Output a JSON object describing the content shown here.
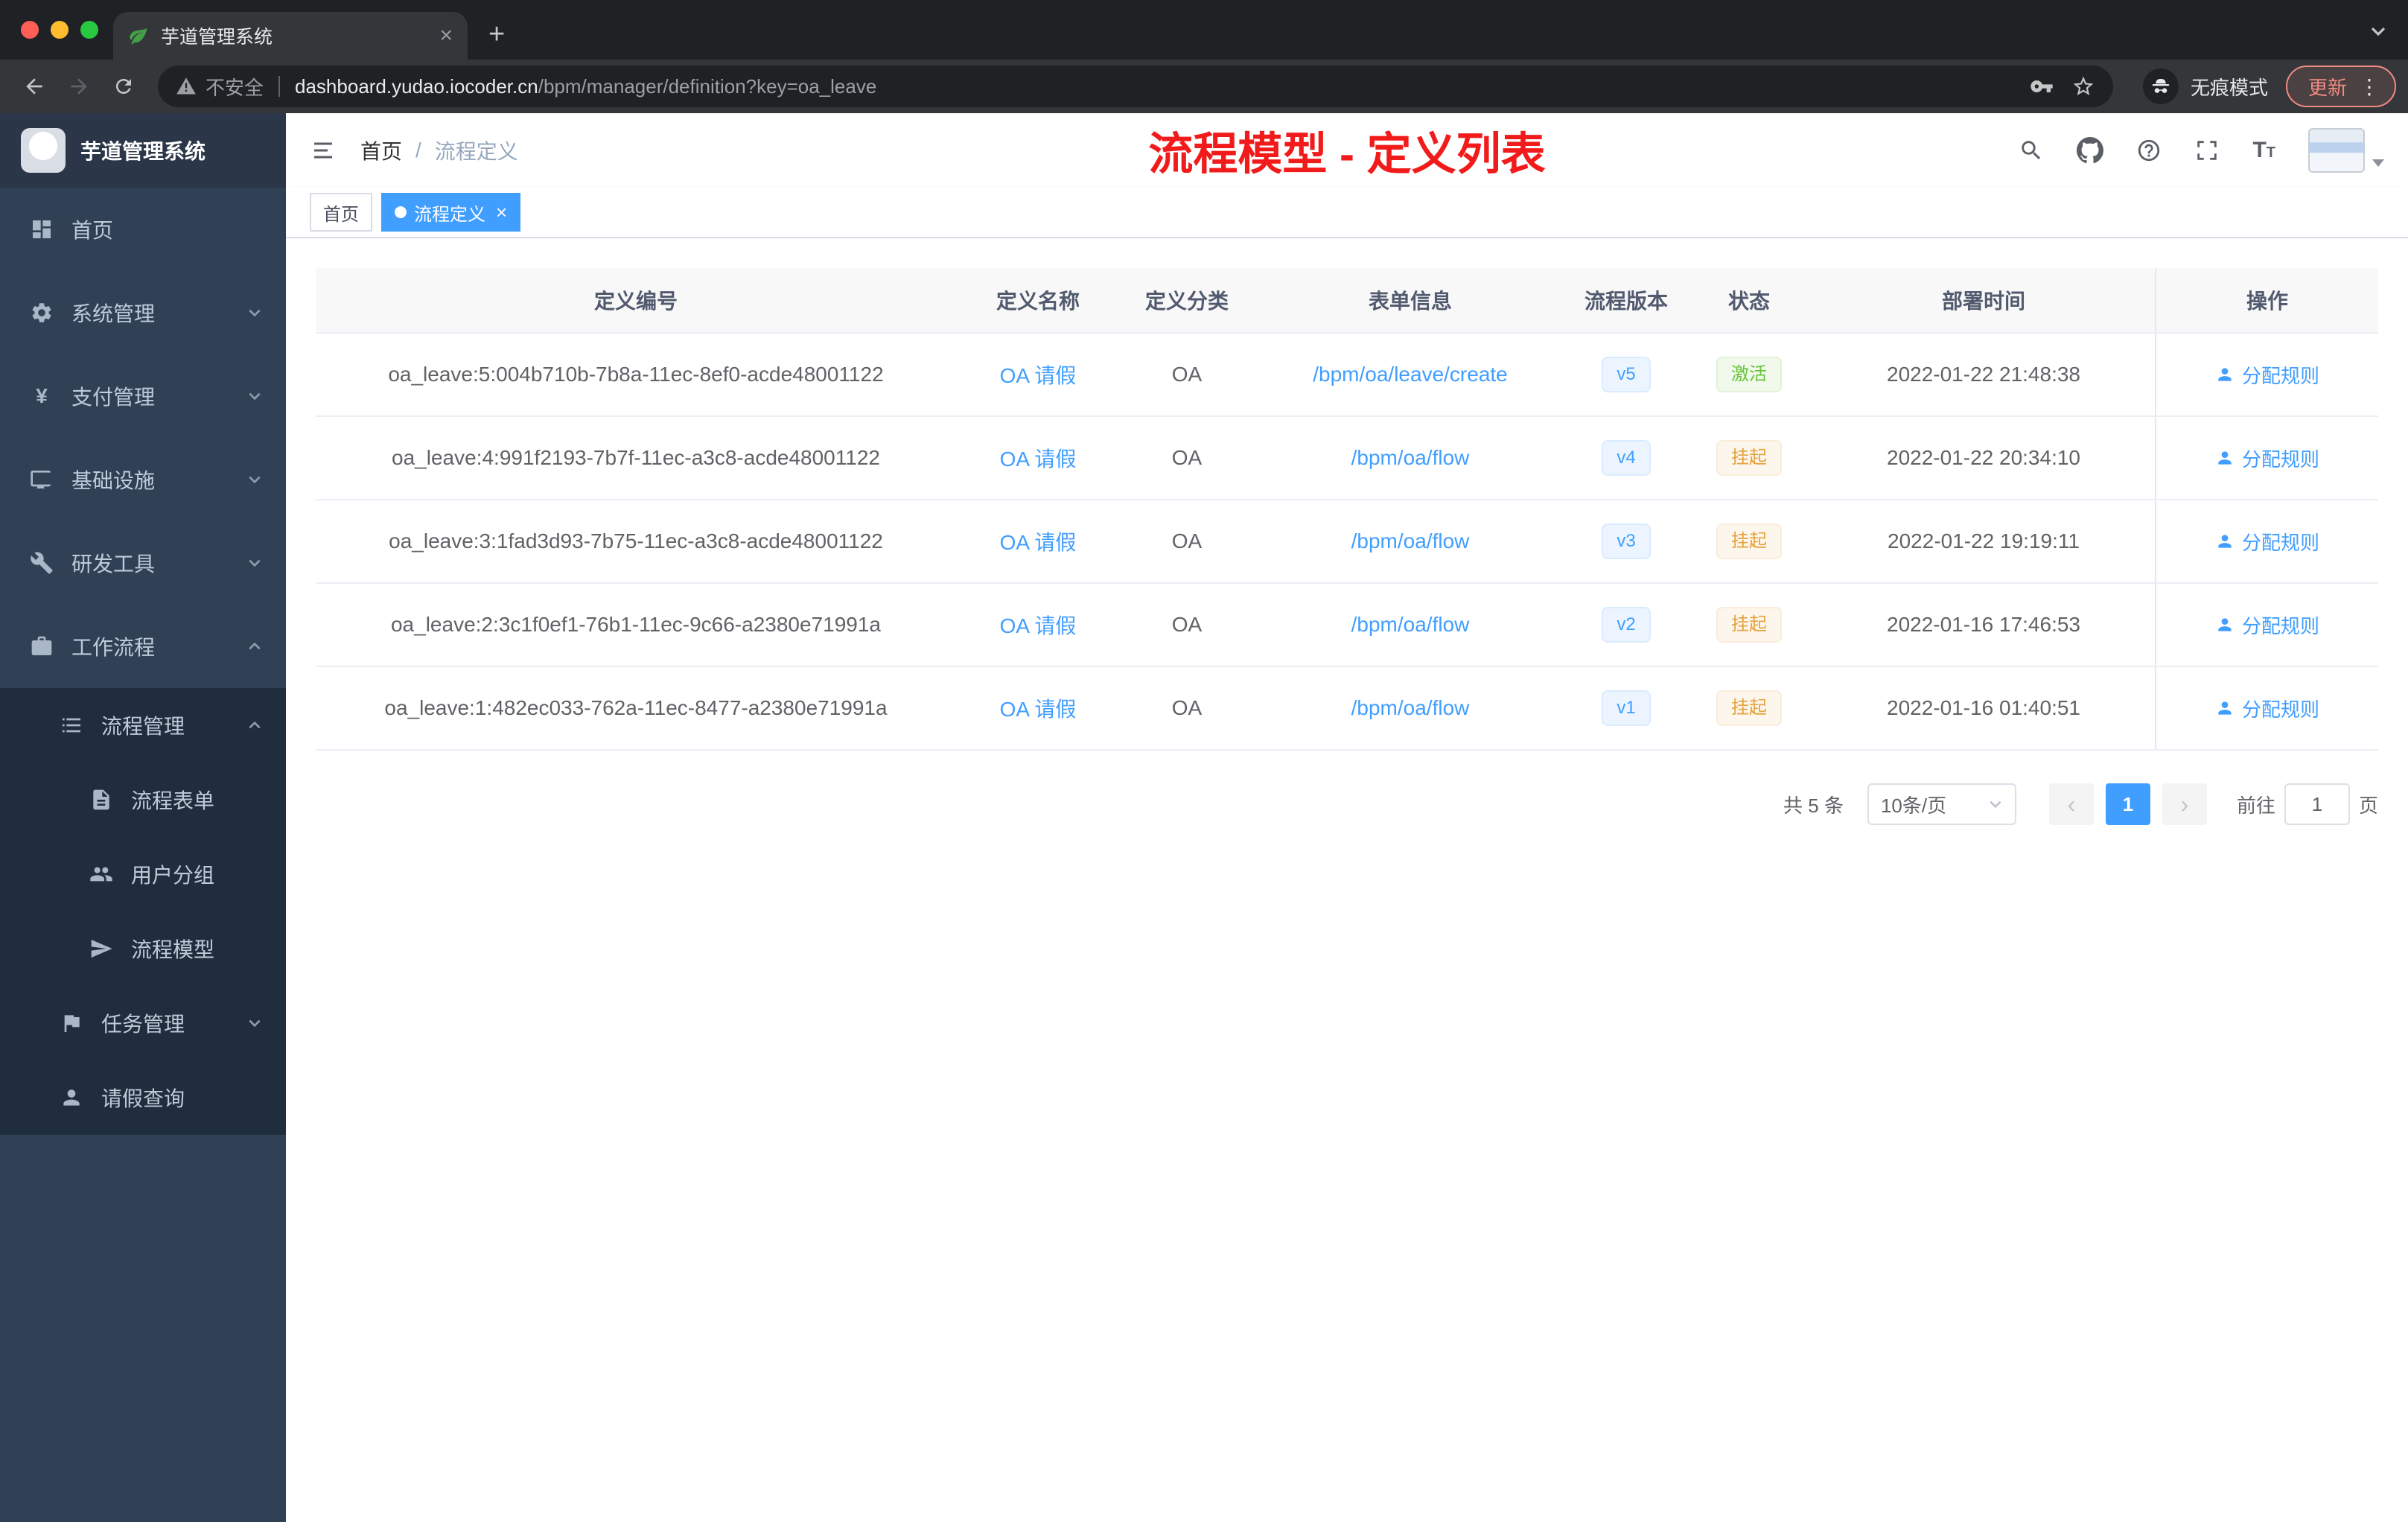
{
  "browser": {
    "tab": {
      "title": "芋道管理系统"
    },
    "address": {
      "security_label": "不安全",
      "domain": "dashboard.yudao.iocoder.cn",
      "path": "/bpm/manager/definition?key=oa_leave"
    },
    "incognito_label": "无痕模式",
    "update_label": "更新"
  },
  "icons": {
    "close": "×",
    "plus": "+",
    "kebab": "⋮",
    "chevron_prev": "‹",
    "chevron_next": "›"
  },
  "sidebar": {
    "logo_title": "芋道管理系统",
    "items": [
      {
        "label": "首页"
      },
      {
        "label": "系统管理"
      },
      {
        "label": "支付管理"
      },
      {
        "label": "基础设施"
      },
      {
        "label": "研发工具"
      },
      {
        "label": "工作流程"
      },
      {
        "label": "流程管理"
      },
      {
        "label": "流程表单"
      },
      {
        "label": "用户分组"
      },
      {
        "label": "流程模型"
      },
      {
        "label": "任务管理"
      },
      {
        "label": "请假查询"
      }
    ]
  },
  "navbar": {
    "breadcrumb": [
      "首页",
      "流程定义"
    ],
    "breadcrumb_separator": "/"
  },
  "annotation": "流程模型 - 定义列表",
  "tags": [
    {
      "label": "首页"
    },
    {
      "label": "流程定义"
    }
  ],
  "table": {
    "columns": [
      "定义编号",
      "定义名称",
      "定义分类",
      "表单信息",
      "流程版本",
      "状态",
      "部署时间",
      "操作"
    ],
    "rows": [
      {
        "id": "oa_leave:5:004b710b-7b8a-11ec-8ef0-acde48001122",
        "name": "OA 请假",
        "category": "OA",
        "form": "/bpm/oa/leave/create",
        "version": "v5",
        "status": "激活",
        "status_type": "success",
        "deploy_time": "2022-01-22 21:48:38",
        "action": "分配规则"
      },
      {
        "id": "oa_leave:4:991f2193-7b7f-11ec-a3c8-acde48001122",
        "name": "OA 请假",
        "category": "OA",
        "form": "/bpm/oa/flow",
        "version": "v4",
        "status": "挂起",
        "status_type": "warning",
        "deploy_time": "2022-01-22 20:34:10",
        "action": "分配规则"
      },
      {
        "id": "oa_leave:3:1fad3d93-7b75-11ec-a3c8-acde48001122",
        "name": "OA 请假",
        "category": "OA",
        "form": "/bpm/oa/flow",
        "version": "v3",
        "status": "挂起",
        "status_type": "warning",
        "deploy_time": "2022-01-22 19:19:11",
        "action": "分配规则"
      },
      {
        "id": "oa_leave:2:3c1f0ef1-76b1-11ec-9c66-a2380e71991a",
        "name": "OA 请假",
        "category": "OA",
        "form": "/bpm/oa/flow",
        "version": "v2",
        "status": "挂起",
        "status_type": "warning",
        "deploy_time": "2022-01-16 17:46:53",
        "action": "分配规则"
      },
      {
        "id": "oa_leave:1:482ec033-762a-11ec-8477-a2380e71991a",
        "name": "OA 请假",
        "category": "OA",
        "form": "/bpm/oa/flow",
        "version": "v1",
        "status": "挂起",
        "status_type": "warning",
        "deploy_time": "2022-01-16 01:40:51",
        "action": "分配规则"
      }
    ]
  },
  "pagination": {
    "total": "共 5 条",
    "page_size": "10条/页",
    "current_page": "1",
    "goto_label": "前往",
    "goto_value": "1",
    "goto_unit": "页"
  },
  "colors": {
    "accent": "#409eff",
    "success": "#67c23a",
    "warning": "#e6a23c",
    "annotation_red": "#f21b1b",
    "sidebar_bg": "#304156",
    "submenu_bg": "#1f2d3d"
  }
}
